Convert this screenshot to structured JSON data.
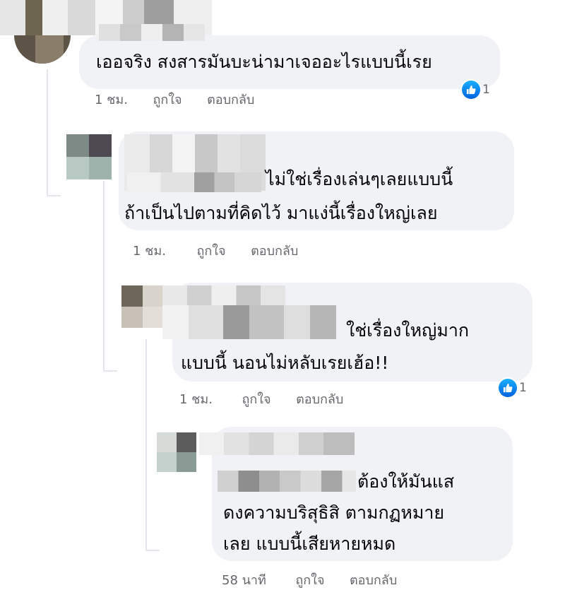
{
  "comments": [
    {
      "lines": [
        "เออจริง สงสารมันบะน่ามาเจออะไรแบบนี้เรย"
      ],
      "time": "1 ชม.",
      "like_label": "ถูกใจ",
      "reply_label": "ตอบกลับ",
      "reaction_count": "1"
    },
    {
      "lines": [
        "ไม่ใช่เรื่องเล่นๆเลยแบบนี้",
        "ถ้าเป็นไปตามที่คิดไว้ มาแง่นี้เรื่องใหญ่เลย"
      ],
      "time": "1 ชม.",
      "like_label": "ถูกใจ",
      "reply_label": "ตอบกลับ"
    },
    {
      "lines": [
        "ใช่เรื่องใหญ่มาก",
        "แบบนี้ นอนไม่หลับเรยเฮ้อ!!"
      ],
      "time": "1 ชม.",
      "like_label": "ถูกใจ",
      "reply_label": "ตอบกลับ",
      "reaction_count": "1"
    },
    {
      "lines": [
        "ต้องให้มันแส",
        "ดงความบริสุธิสิ ตามกฏหมาย",
        "เลย แบบนี้เสียหายหมด"
      ],
      "time": "58 นาที",
      "like_label": "ถูกใจ",
      "reply_label": "ตอบกลับ"
    }
  ],
  "colors": {
    "bubble": "#f0f2f5",
    "meta_text": "#65676b",
    "like_blue": "#1877f2"
  },
  "icons": [
    "like-icon"
  ]
}
